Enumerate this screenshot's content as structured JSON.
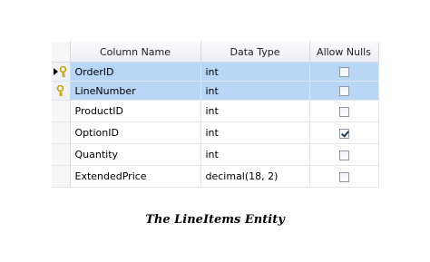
{
  "columns": {
    "name": "Column Name",
    "type": "Data Type",
    "nulls": "Allow Nulls"
  },
  "rows": [
    {
      "name": "OrderID",
      "type": "int",
      "allow_nulls": false,
      "primary_key": true,
      "current": true,
      "highlighted": true
    },
    {
      "name": "LineNumber",
      "type": "int",
      "allow_nulls": false,
      "primary_key": true,
      "current": false,
      "highlighted": true
    },
    {
      "name": "ProductID",
      "type": "int",
      "allow_nulls": false,
      "primary_key": false,
      "current": false,
      "highlighted": false
    },
    {
      "name": "OptionID",
      "type": "int",
      "allow_nulls": true,
      "primary_key": false,
      "current": false,
      "highlighted": false
    },
    {
      "name": "Quantity",
      "type": "int",
      "allow_nulls": false,
      "primary_key": false,
      "current": false,
      "highlighted": false
    },
    {
      "name": "ExtendedPrice",
      "type": "decimal(18, 2)",
      "allow_nulls": false,
      "primary_key": false,
      "current": false,
      "highlighted": false
    }
  ],
  "icons": {
    "row_selector": "current-row-arrow-icon",
    "primary_key": "key-icon"
  },
  "colors": {
    "selection": "#b8d6f6",
    "key": "#c9a200"
  },
  "caption": "The LineItems Entity"
}
